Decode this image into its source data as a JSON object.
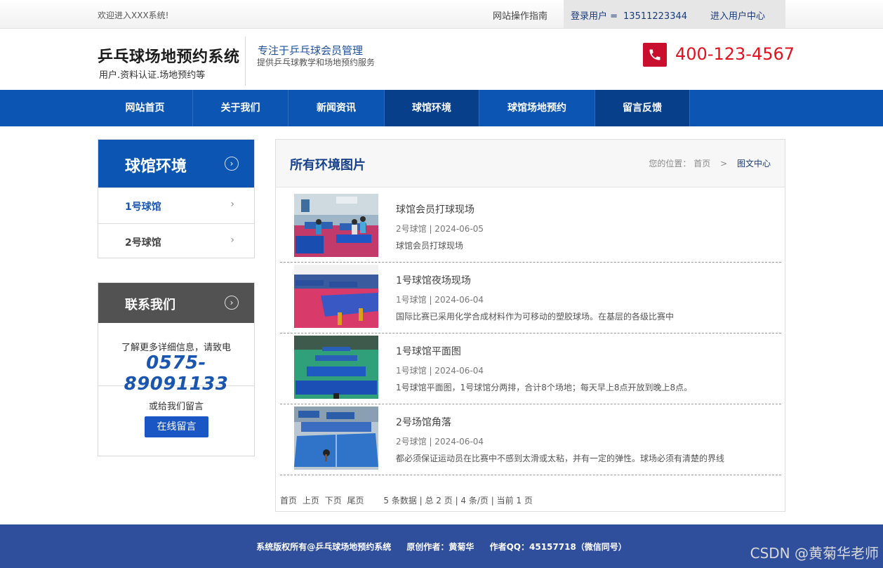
{
  "topbar": {
    "welcome": "欢迎进入XXX系统!",
    "guide": "网站操作指南",
    "login_label": "登录用户 =",
    "login_phone": "13511223344",
    "user_center": "进入用户中心"
  },
  "header": {
    "title": "乒乓球场地预约系统",
    "subtitle": "用户.资料认证.场地预约等",
    "slogan": "专注于乒乓球会员管理",
    "slogan_sub": "提供乒乓球教学和场地预约服务",
    "hotline": "400-123-4567",
    "phone_icon": "phone-icon"
  },
  "nav": {
    "items": [
      "网站首页",
      "关于我们",
      "新闻资讯",
      "球馆环境",
      "球馆场地预约",
      "留言反馈"
    ],
    "active": "球馆环境"
  },
  "sidebar": {
    "title": "球馆环境",
    "items": [
      {
        "label": "1号球馆"
      },
      {
        "label": "2号球馆"
      }
    ]
  },
  "contact": {
    "title": "联系我们",
    "info": "了解更多详细信息，请致电",
    "phone": "0575-89091133",
    "or_message": "或给我们留言",
    "button": "在线留言"
  },
  "main": {
    "title": "所有环境图片",
    "breadcrumb": {
      "prefix": "您的位置：",
      "home": "首页",
      "sep": ">",
      "current": "图文中心"
    },
    "entries": [
      {
        "title": "球馆会员打球现场",
        "meta": "2号球馆 | 2024-06-05",
        "desc": "球馆会员打球现场"
      },
      {
        "title": "1号球馆夜场现场",
        "meta": "1号球馆 | 2024-06-04",
        "desc": "国际比赛已采用化学合成材料作为可移动的塑胶球场。在基层的各级比赛中"
      },
      {
        "title": "1号球馆平面图",
        "meta": "1号球馆 | 2024-06-04",
        "desc": "1号球馆平面图，1号球馆分两排，合计8个场地；每天早上8点开放到晚上8点。"
      },
      {
        "title": "2号场馆角落",
        "meta": "2号球馆 | 2024-06-04",
        "desc": "都必须保证运动员在比赛中不感到太滑或太粘，并有一定的弹性。球场必须有清楚的界线"
      }
    ],
    "pager": {
      "first": "首页",
      "prev": "上页",
      "next": "下页",
      "last": "尾页",
      "info": "5 条数据 | 总 2 页 | 4 条/页 | 当前 1 页"
    }
  },
  "footer": {
    "copyright": "系统版权所有@乒乓球场地预约系统",
    "author": "原创作者：黄菊华",
    "qq": "作者QQ：45157718（微信同号）"
  },
  "watermark": "CSDN @黄菊华老师",
  "colors": {
    "nav_blue": "#0c55b2",
    "nav_active": "#073f8a",
    "hotline_red": "#e3101e",
    "footer_blue": "#2f4f9d"
  }
}
